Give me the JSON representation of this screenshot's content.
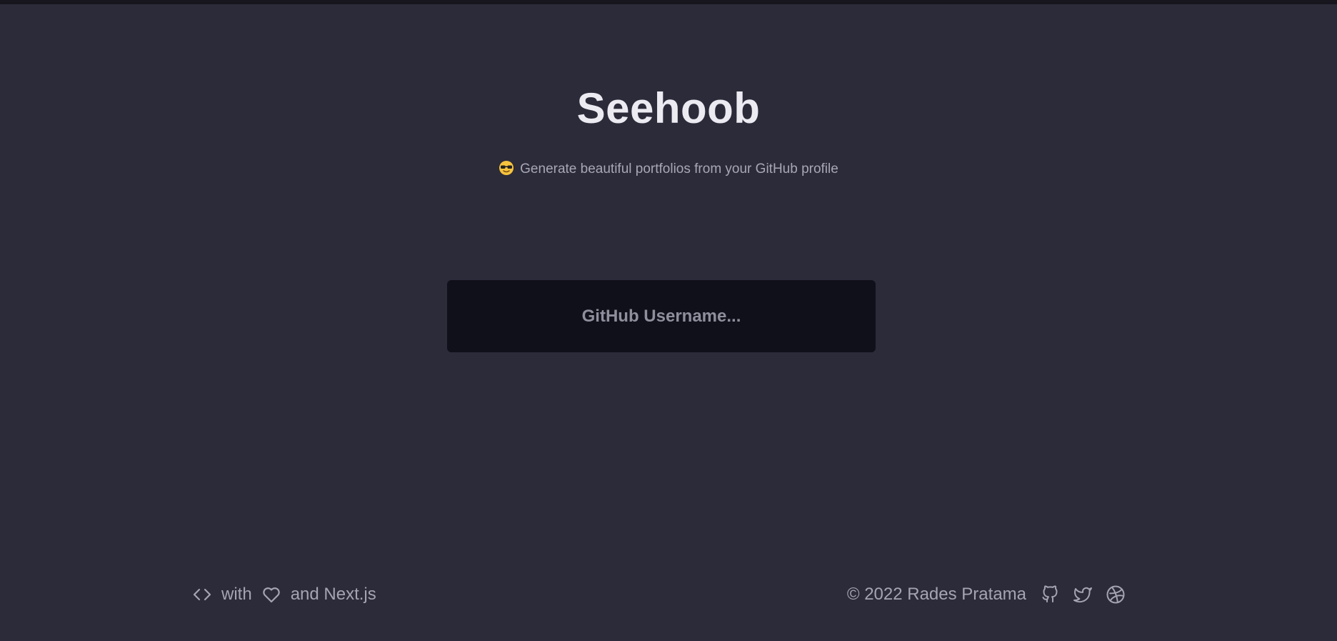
{
  "hero": {
    "title": "Seehoob",
    "subtitle": "Generate beautiful portfolios from your GitHub profile",
    "emoji_icon": "sunglasses-emoji-icon"
  },
  "search": {
    "placeholder": "GitHub Username...",
    "value": ""
  },
  "footer": {
    "made_with": {
      "with_text": "with",
      "and_text": "and Next.js",
      "code_icon": "code-brackets-icon",
      "heart_icon": "heart-icon"
    },
    "copyright": "© 2022 Rades Pratama",
    "social": [
      {
        "name": "github-icon"
      },
      {
        "name": "twitter-icon"
      },
      {
        "name": "dribbble-icon"
      }
    ]
  },
  "colors": {
    "background": "#2c2b3a",
    "input_background": "#10101a",
    "text_primary": "#ecebf2",
    "text_muted": "#a5a4b2"
  }
}
